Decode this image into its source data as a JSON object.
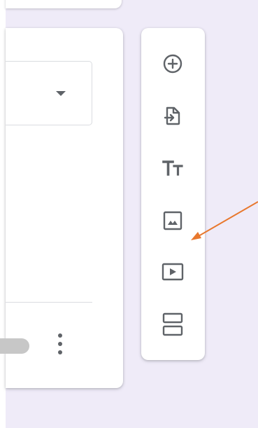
{
  "colors": {
    "canvas_background": "#efebf8",
    "card_background": "#ffffff",
    "icon_color": "#5f6368",
    "annotation_arrow": "#e8782e",
    "toggle_off": "#c7c7c7"
  },
  "question_card": {
    "question_type_dropdown": {
      "selected_value": "",
      "icon": "arrow-drop-down-icon"
    },
    "required_toggle": {
      "state": "off"
    },
    "more_options": {
      "icon": "more-vert-icon"
    }
  },
  "toolbar": {
    "items": [
      {
        "name": "add-question",
        "icon": "add-circle-icon"
      },
      {
        "name": "import-questions",
        "icon": "import-file-icon"
      },
      {
        "name": "add-title-and-description",
        "icon": "text-fields-icon"
      },
      {
        "name": "add-image",
        "icon": "image-icon"
      },
      {
        "name": "add-video",
        "icon": "video-play-icon"
      },
      {
        "name": "add-section",
        "icon": "section-icon"
      }
    ]
  },
  "annotation": {
    "type": "arrow",
    "points_to": "add-image"
  }
}
